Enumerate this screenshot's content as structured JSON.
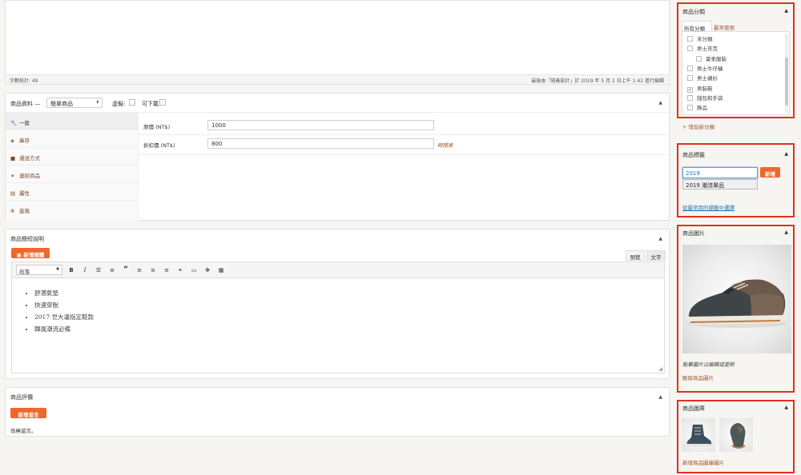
{
  "editor_top": {
    "word_count": "字數統計: 49",
    "last_edited": "最後由「隨善設計」於 2019 年 5 月 2 日上午 1:42 進行編輯"
  },
  "product_data": {
    "title": "商品資料 —",
    "type_select": "簡單商品",
    "virtual_label": "虛擬:",
    "downloadable_label": "可下載:",
    "tabs": [
      {
        "label": "一般",
        "icon": "wrench-icon",
        "glyph": "🔧"
      },
      {
        "label": "庫存",
        "icon": "inventory-icon",
        "glyph": "◈"
      },
      {
        "label": "運送方式",
        "icon": "truck-icon",
        "glyph": "■"
      },
      {
        "label": "連結商品",
        "icon": "link-icon",
        "glyph": "⚭"
      },
      {
        "label": "屬性",
        "icon": "table-icon",
        "glyph": "▤"
      },
      {
        "label": "進階",
        "icon": "gear-icon",
        "glyph": "✲"
      }
    ],
    "regular_price_label": "原價 (NT$)",
    "regular_price": "1000",
    "sale_price_label": "折扣價 (NT$)",
    "sale_price": "800",
    "schedule_link": "時間表"
  },
  "short_desc": {
    "title": "商品簡短說明",
    "add_media": "新增媒體",
    "tab_visual": "預覽",
    "tab_text": "文字",
    "format_select": "段落",
    "bullets": [
      "舒適氣墊",
      "快速穿脫",
      "2017 世大運指定鞋款",
      "韓風潮流必備"
    ]
  },
  "reviews": {
    "title": "商品評價",
    "add_button": "新增留言",
    "empty_text": "尚無留言。"
  },
  "categories": {
    "title": "商品分類",
    "tab_all": "所有分類",
    "tab_popular": "最常使用",
    "items": [
      {
        "label": "未分類",
        "checked": false,
        "indent": 0
      },
      {
        "label": "男士夾克",
        "checked": false,
        "indent": 0
      },
      {
        "label": "夏季服裝",
        "checked": false,
        "indent": 1
      },
      {
        "label": "男士牛仔褲",
        "checked": false,
        "indent": 0
      },
      {
        "label": "男士襯衫",
        "checked": false,
        "indent": 0
      },
      {
        "label": "男裝鞋",
        "checked": true,
        "indent": 0
      },
      {
        "label": "錢包和手袋",
        "checked": false,
        "indent": 0
      },
      {
        "label": "飾品",
        "checked": false,
        "indent": 0
      }
    ],
    "add_link": "+ 增加新分類"
  },
  "tags": {
    "title": "商品標籤",
    "input_value": "2019",
    "add_button": "新增",
    "suggestion": "2019 潮流單品",
    "popular_link": "從最常用的標籤中選擇"
  },
  "product_image": {
    "title": "商品圖片",
    "hint": "點擊圖片以編輯或更新",
    "remove_link": "刪除商品圖片"
  },
  "gallery": {
    "title": "商品圖庫",
    "add_link": "新增商品圖庫圖片"
  },
  "colors": {
    "accent": "#f0672a",
    "highlight_border": "#e0301e",
    "link": "#a0522d"
  }
}
